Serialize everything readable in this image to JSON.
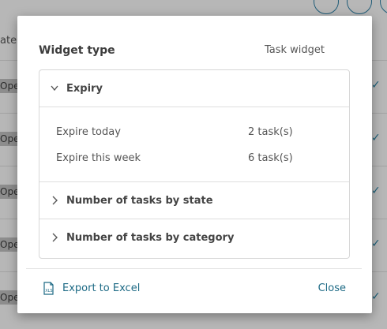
{
  "background": {
    "state_header": "ate",
    "row_badge": "Ope",
    "row_count": 5
  },
  "modal": {
    "widget_type_label": "Widget type",
    "widget_type_value": "Task widget",
    "sections": [
      {
        "title": "Expiry",
        "expanded": true,
        "rows": [
          {
            "label": "Expire today",
            "value": "2 task(s)"
          },
          {
            "label": "Expire this week",
            "value": "6 task(s)"
          }
        ]
      },
      {
        "title": "Number of tasks by state",
        "expanded": false
      },
      {
        "title": "Number of tasks by category",
        "expanded": false
      }
    ],
    "footer": {
      "export_label": "Export to Excel",
      "close_label": "Close"
    }
  },
  "colors": {
    "link": "#1d6a85",
    "overlay": "#b7b7b7"
  }
}
